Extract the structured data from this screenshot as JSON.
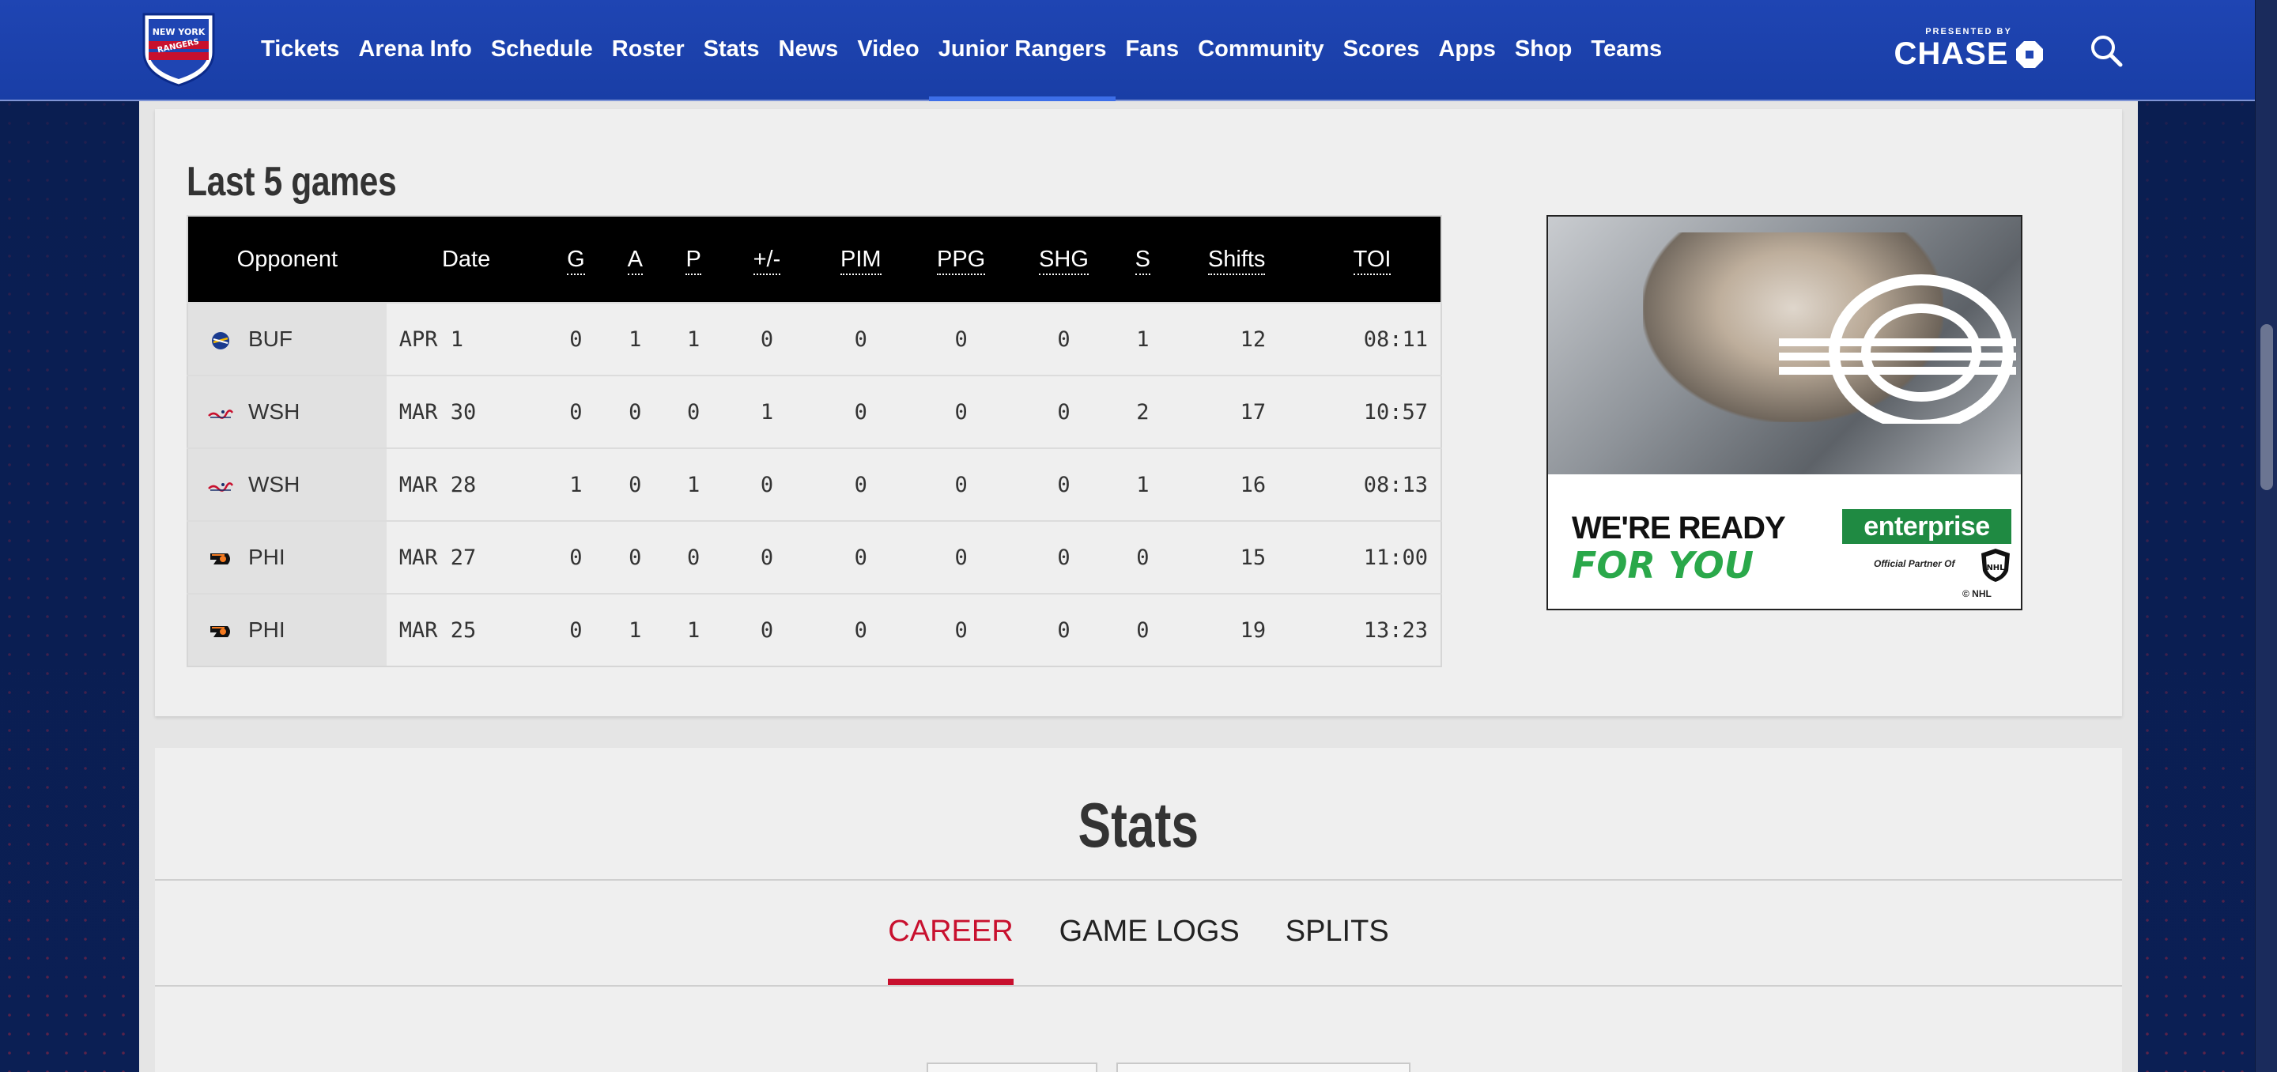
{
  "header": {
    "logo_alt": "NEW YORK RANGERS",
    "nav": [
      {
        "label": "Tickets",
        "active": false
      },
      {
        "label": "Arena Info",
        "active": false
      },
      {
        "label": "Schedule",
        "active": false
      },
      {
        "label": "Roster",
        "active": false
      },
      {
        "label": "Stats",
        "active": false
      },
      {
        "label": "News",
        "active": false
      },
      {
        "label": "Video",
        "active": false
      },
      {
        "label": "Junior Rangers",
        "active": true
      },
      {
        "label": "Fans",
        "active": false
      },
      {
        "label": "Community",
        "active": false
      },
      {
        "label": "Scores",
        "active": false
      },
      {
        "label": "Apps",
        "active": false
      },
      {
        "label": "Shop",
        "active": false
      },
      {
        "label": "Teams",
        "active": false
      }
    ],
    "sponsor_presented": "PRESENTED BY",
    "sponsor_name": "CHASE"
  },
  "last_games": {
    "heading": "Last 5 games",
    "columns": [
      "Opponent",
      "Date",
      "G",
      "A",
      "P",
      "+/-",
      "PIM",
      "PPG",
      "SHG",
      "S",
      "Shifts",
      "TOI"
    ],
    "rows": [
      {
        "team": "BUF",
        "logo": "sabres-logo-icon",
        "date": "APR 1",
        "g": "0",
        "a": "1",
        "p": "1",
        "pm": "0",
        "pim": "0",
        "ppg": "0",
        "shg": "0",
        "s": "1",
        "shifts": "12",
        "toi": "08:11"
      },
      {
        "team": "WSH",
        "logo": "capitals-logo-icon",
        "date": "MAR 30",
        "g": "0",
        "a": "0",
        "p": "0",
        "pm": "1",
        "pim": "0",
        "ppg": "0",
        "shg": "0",
        "s": "2",
        "shifts": "17",
        "toi": "10:57"
      },
      {
        "team": "WSH",
        "logo": "capitals-logo-icon",
        "date": "MAR 28",
        "g": "1",
        "a": "0",
        "p": "1",
        "pm": "0",
        "pim": "0",
        "ppg": "0",
        "shg": "0",
        "s": "1",
        "shifts": "16",
        "toi": "08:13"
      },
      {
        "team": "PHI",
        "logo": "flyers-logo-icon",
        "date": "MAR 27",
        "g": "0",
        "a": "0",
        "p": "0",
        "pm": "0",
        "pim": "0",
        "ppg": "0",
        "shg": "0",
        "s": "0",
        "shifts": "15",
        "toi": "11:00"
      },
      {
        "team": "PHI",
        "logo": "flyers-logo-icon",
        "date": "MAR 25",
        "g": "0",
        "a": "1",
        "p": "1",
        "pm": "0",
        "pim": "0",
        "ppg": "0",
        "shg": "0",
        "s": "0",
        "shifts": "19",
        "toi": "13:23"
      }
    ]
  },
  "ad": {
    "headline": "WE'RE READY",
    "subline": "FOR YOU",
    "brand": "enterprise",
    "partner": "Official Partner Of",
    "copyright": "© NHL"
  },
  "stats": {
    "title": "Stats",
    "tabs": [
      {
        "label": "CAREER",
        "active": true
      },
      {
        "label": "GAME LOGS",
        "active": false
      },
      {
        "label": "SPLITS",
        "active": false
      }
    ]
  },
  "colors": {
    "nav_bg": "#1f45b3",
    "accent_red": "#c8102e",
    "table_header_bg": "#000000"
  }
}
